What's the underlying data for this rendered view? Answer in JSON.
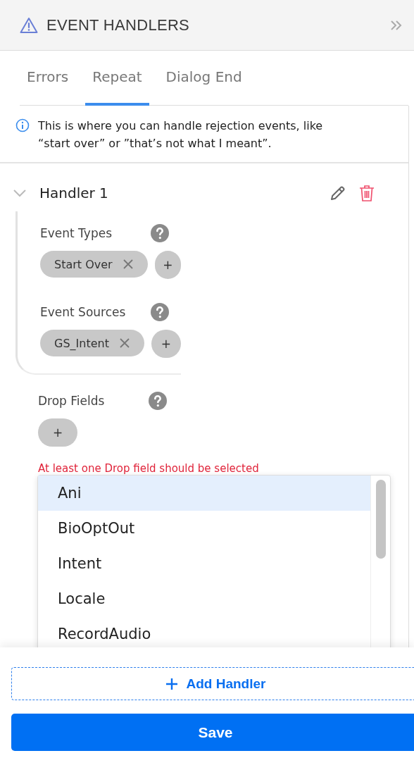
{
  "header": {
    "title": "EVENT HANDLERS"
  },
  "tabs": [
    {
      "label": "Errors",
      "selected": false
    },
    {
      "label": "Repeat",
      "selected": true
    },
    {
      "label": "Dialog End",
      "selected": false
    }
  ],
  "info": "This is where you can handle rejection events, like “start over” or ”that’s not what I meant”.",
  "handler": {
    "title": "Handler 1",
    "expanded": true,
    "groups": [
      {
        "label": "Event Types",
        "chips": [
          "Start Over"
        ],
        "add": "+"
      },
      {
        "label": "Event Sources",
        "chips": [
          "GS_Intent"
        ],
        "add": "+"
      }
    ]
  },
  "drop_fields": {
    "label": "Drop Fields",
    "add": "+",
    "error": "At least one Drop field should be selected",
    "options": [
      {
        "label": "Ani",
        "selected": true
      },
      {
        "label": "BioOptOut",
        "selected": false
      },
      {
        "label": "Intent",
        "selected": false
      },
      {
        "label": "Locale",
        "selected": false
      },
      {
        "label": "RecordAudio",
        "selected": false
      }
    ]
  },
  "footer": {
    "add_label": "Add Handler",
    "save_label": "Save"
  }
}
